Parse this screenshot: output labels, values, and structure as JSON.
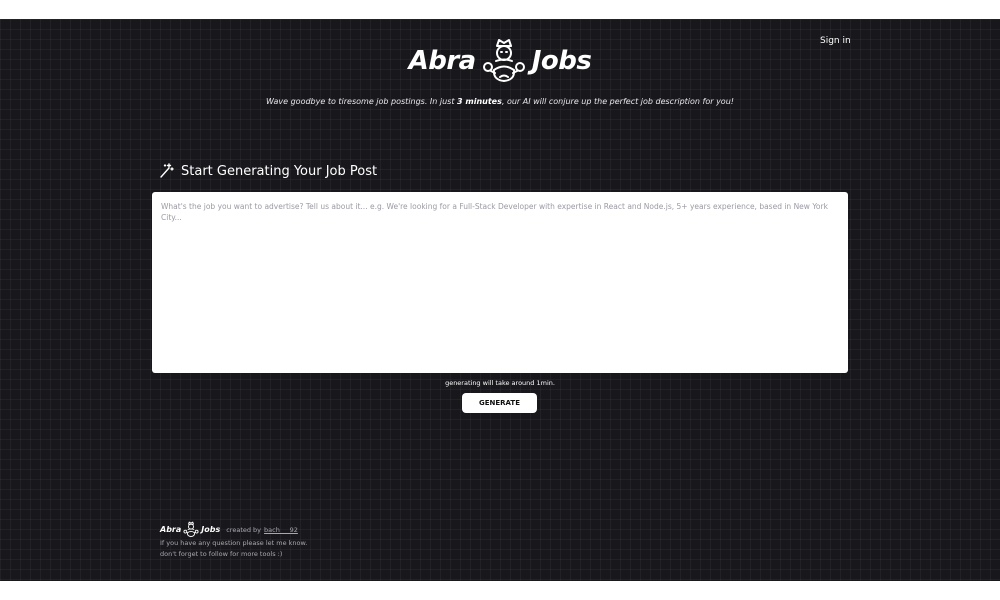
{
  "header": {
    "signin_label": "Sign in",
    "brand_left": "Abra",
    "brand_right": "Jobs",
    "logo_icon": "genie-lamp-icon",
    "tagline_pre": "Wave goodbye to tiresome job postings. In just ",
    "tagline_bold": "3 minutes",
    "tagline_post": ", our AI will conjure up the perfect job description for you!"
  },
  "main": {
    "section_icon": "magic-wand-icon",
    "section_title": "Start Generating Your Job Post",
    "prompt_placeholder": "What's the job you want to advertise? Tell us about it... e.g. We're looking for a Full-Stack Developer with expertise in React and Node.js, 5+ years experience, based in New York City...",
    "prompt_value": "",
    "hint": "generating will take around 1min.",
    "generate_label": "GENERATE"
  },
  "footer": {
    "brand_left": "Abra",
    "brand_right": "Jobs",
    "created_by": "created by",
    "author_link": "bach___92",
    "line1": "If you have any question please let me know.",
    "line2": "don't forget to follow for more tools :)"
  },
  "colors": {
    "background": "#17171c",
    "text": "#ffffff",
    "muted": "#a8a8b0",
    "button_bg": "#ffffff"
  }
}
